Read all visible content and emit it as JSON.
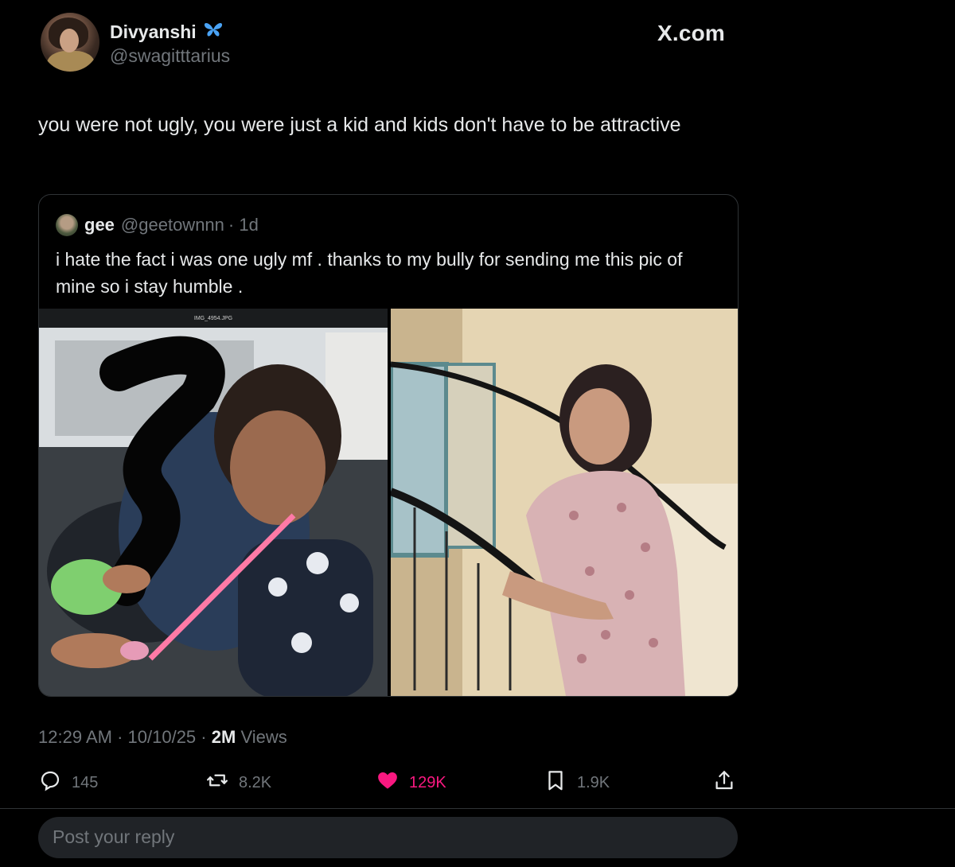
{
  "author": {
    "name": "Divyanshi",
    "badge_icon": "butterfly-icon",
    "handle": "@swagitttarius"
  },
  "site_label": "X.com",
  "tweet": {
    "text": "you were not ugly, you were just a kid and kids don't have to be attractive"
  },
  "quoted_tweet": {
    "name": "gee",
    "handle": "@geetownnn",
    "age": "· 1d",
    "text": "i hate the fact i was one ugly mf . thanks to my bully for sending me this pic of mine so i stay humble .",
    "left_photo_caption": "IMG_4954.JPG"
  },
  "meta": {
    "time": "12:29 AM",
    "date": "10/10/25",
    "views_count": "2M",
    "views_label": "Views"
  },
  "actions": {
    "replies": "145",
    "reposts": "8.2K",
    "likes": "129K",
    "bookmarks": "1.9K",
    "like_color": "#f91880"
  },
  "reply": {
    "placeholder": "Post your reply"
  }
}
